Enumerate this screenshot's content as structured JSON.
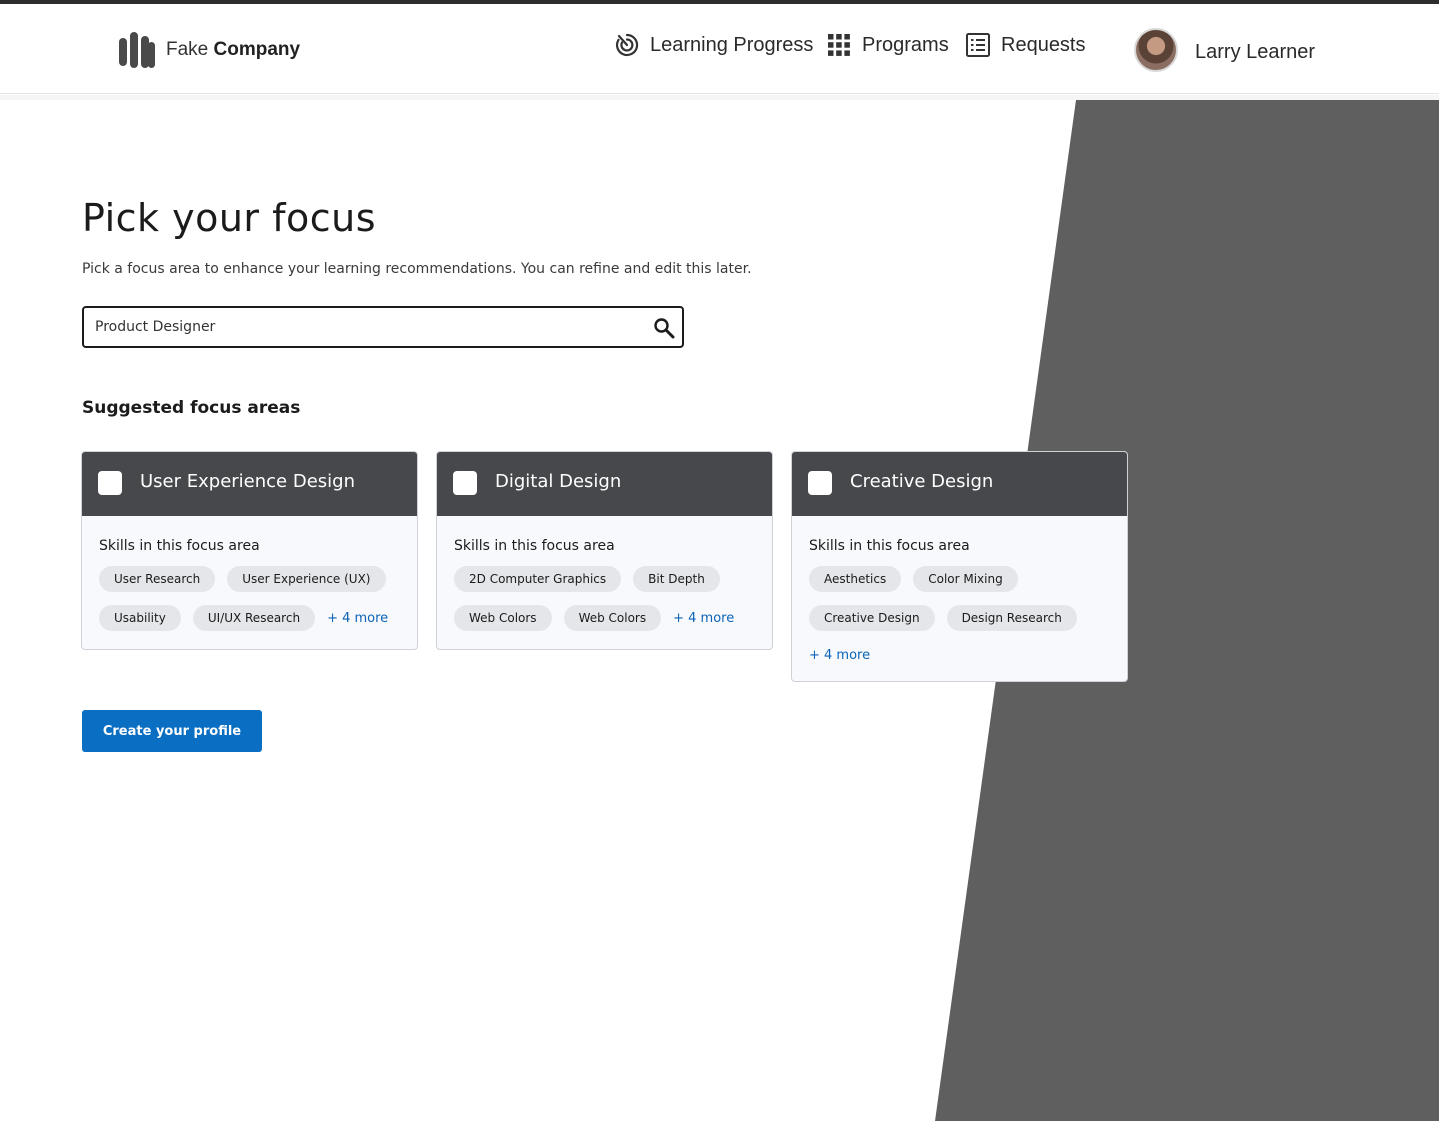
{
  "header": {
    "brand": {
      "light": "Fake",
      "bold": "Company"
    },
    "nav": [
      {
        "label": "Learning Progress",
        "icon": "progress-icon"
      },
      {
        "label": "Programs",
        "icon": "grid-icon"
      },
      {
        "label": "Requests",
        "icon": "checklist-icon"
      }
    ],
    "user": {
      "name": "Larry Learner"
    }
  },
  "main": {
    "title": "Pick your focus",
    "subtitle": "Pick a focus area to enhance your learning recommendations. You can refine and edit this later.",
    "search": {
      "value": "Product Designer",
      "icon": "search-icon"
    },
    "section_title": "Suggested focus areas",
    "cards": [
      {
        "title": "User Experience Design",
        "subtitle": "Skills in this focus area",
        "skills": [
          "User Research",
          "User Experience (UX)",
          "Usability",
          "UI/UX Research"
        ],
        "more": "+ 4 more"
      },
      {
        "title": "Digital Design",
        "subtitle": "Skills in this focus area",
        "skills": [
          "2D Computer Graphics",
          "Bit Depth",
          "Web Colors",
          "Web Colors"
        ],
        "more": "+ 4 more"
      },
      {
        "title": "Creative Design",
        "subtitle": "Skills in this focus area",
        "skills": [
          "Aesthetics",
          "Color Mixing",
          "Creative Design",
          "Design Research"
        ],
        "more": "+ 4 more"
      }
    ],
    "cta": "Create your profile"
  },
  "colors": {
    "header_bar": "#2d2d2d",
    "card_header": "#46484b",
    "background_shape": "#5f5f5f",
    "primary_button": "#0a6ec2",
    "link": "#0b63b7"
  }
}
